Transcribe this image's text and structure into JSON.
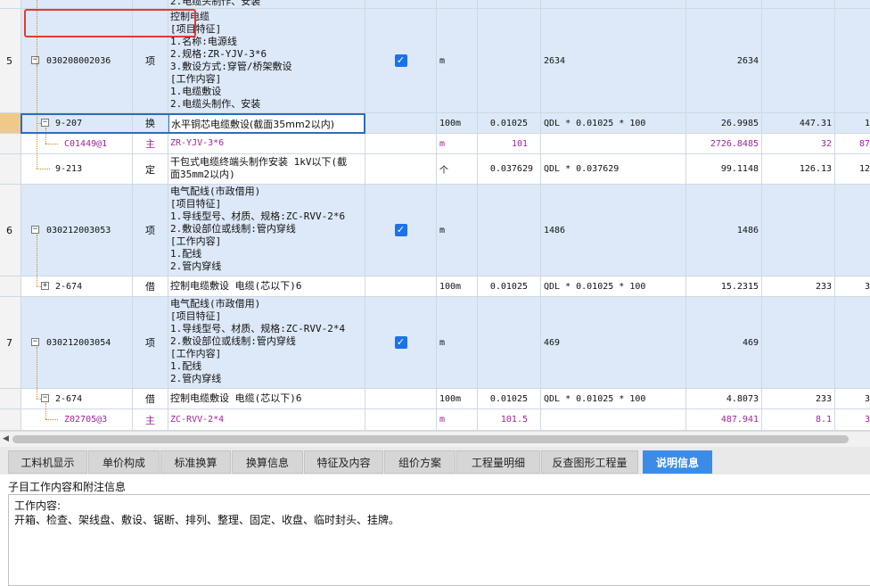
{
  "rows": {
    "r0": {
      "name": "2.电缆头制作、安装"
    },
    "r5": {
      "index": "5",
      "code": "030208002036",
      "type": "项",
      "name": "控制电缆\n[项目特征]\n1.名称:电源线\n2.规格:ZR-YJV-3*6\n3.敷设方式:穿管/桥架敷设\n[工作内容]\n1.电缆敷设\n2.电缆头制作、安装",
      "unit": "m",
      "expr": "2634",
      "amount": "2634"
    },
    "r5a": {
      "code": "9-207",
      "type": "换",
      "name": "水平铜芯电缆敷设(截面35mm2以内)",
      "unit": "100m",
      "qty": "0.01025",
      "expr": "QDL * 0.01025 * 100",
      "amount": "26.9985",
      "price": "447.31",
      "last": "1"
    },
    "r5b": {
      "code": "C01449@1",
      "type": "主",
      "name": "ZR-YJV-3*6",
      "unit": "m",
      "qty": "101",
      "amount": "2726.8485",
      "price": "32",
      "last": "87"
    },
    "r5c": {
      "code": "9-213",
      "type": "定",
      "name": "干包式电缆终端头制作安装 1kV以下(截\n面35mm2以内)",
      "unit": "个",
      "qty": "0.037629",
      "expr": "QDL * 0.037629",
      "amount": "99.1148",
      "price": "126.13",
      "last": "12"
    },
    "r6": {
      "index": "6",
      "code": "030212003053",
      "type": "项",
      "name": "电气配线(市政借用)\n[项目特征]\n1.导线型号、材质、规格:ZC-RVV-2*6\n2.敷设部位或线制:管内穿线\n[工作内容]\n1.配线\n2.管内穿线",
      "unit": "m",
      "expr": "1486",
      "amount": "1486"
    },
    "r6a": {
      "code": "2-674",
      "type": "借",
      "name": "控制电缆敷设 电缆(芯以下)6",
      "unit": "100m",
      "qty": "0.01025",
      "expr": "QDL * 0.01025 * 100",
      "amount": "15.2315",
      "price": "233",
      "last": "3"
    },
    "r7": {
      "index": "7",
      "code": "030212003054",
      "type": "项",
      "name": "电气配线(市政借用)\n[项目特征]\n1.导线型号、材质、规格:ZC-RVV-2*4\n2.敷设部位或线制:管内穿线\n[工作内容]\n1.配线\n2.管内穿线",
      "unit": "m",
      "expr": "469",
      "amount": "469"
    },
    "r7a": {
      "code": "2-674",
      "type": "借",
      "name": "控制电缆敷设 电缆(芯以下)6",
      "unit": "100m",
      "qty": "0.01025",
      "expr": "QDL * 0.01025 * 100",
      "amount": "4.8073",
      "price": "233",
      "last": "3"
    },
    "r7b": {
      "code": "Z02705@3",
      "type": "主",
      "name": "ZC-RVV-2*4",
      "unit": "m",
      "qty": "101.5",
      "amount": "487.941",
      "price": "8.1",
      "last": "3"
    }
  },
  "tabs": [
    "工料机显示",
    "单价构成",
    "标准换算",
    "换算信息",
    "特征及内容",
    "组价方案",
    "工程量明细",
    "反查图形工程量",
    "说明信息"
  ],
  "active_tab": "说明信息",
  "panel": {
    "title": "子目工作内容和附注信息",
    "line1": "工作内容:",
    "line2": "开箱、检查、架线盘、敷设、锯断、排列、整理、固定、收盘、临时封头、挂牌。"
  },
  "colors": {
    "item_row": "#dde9f8",
    "material_text": "#a0259a",
    "active_tab": "#3c8ce7",
    "highlight": "#e53935",
    "checkbox": "#1a73e8"
  }
}
